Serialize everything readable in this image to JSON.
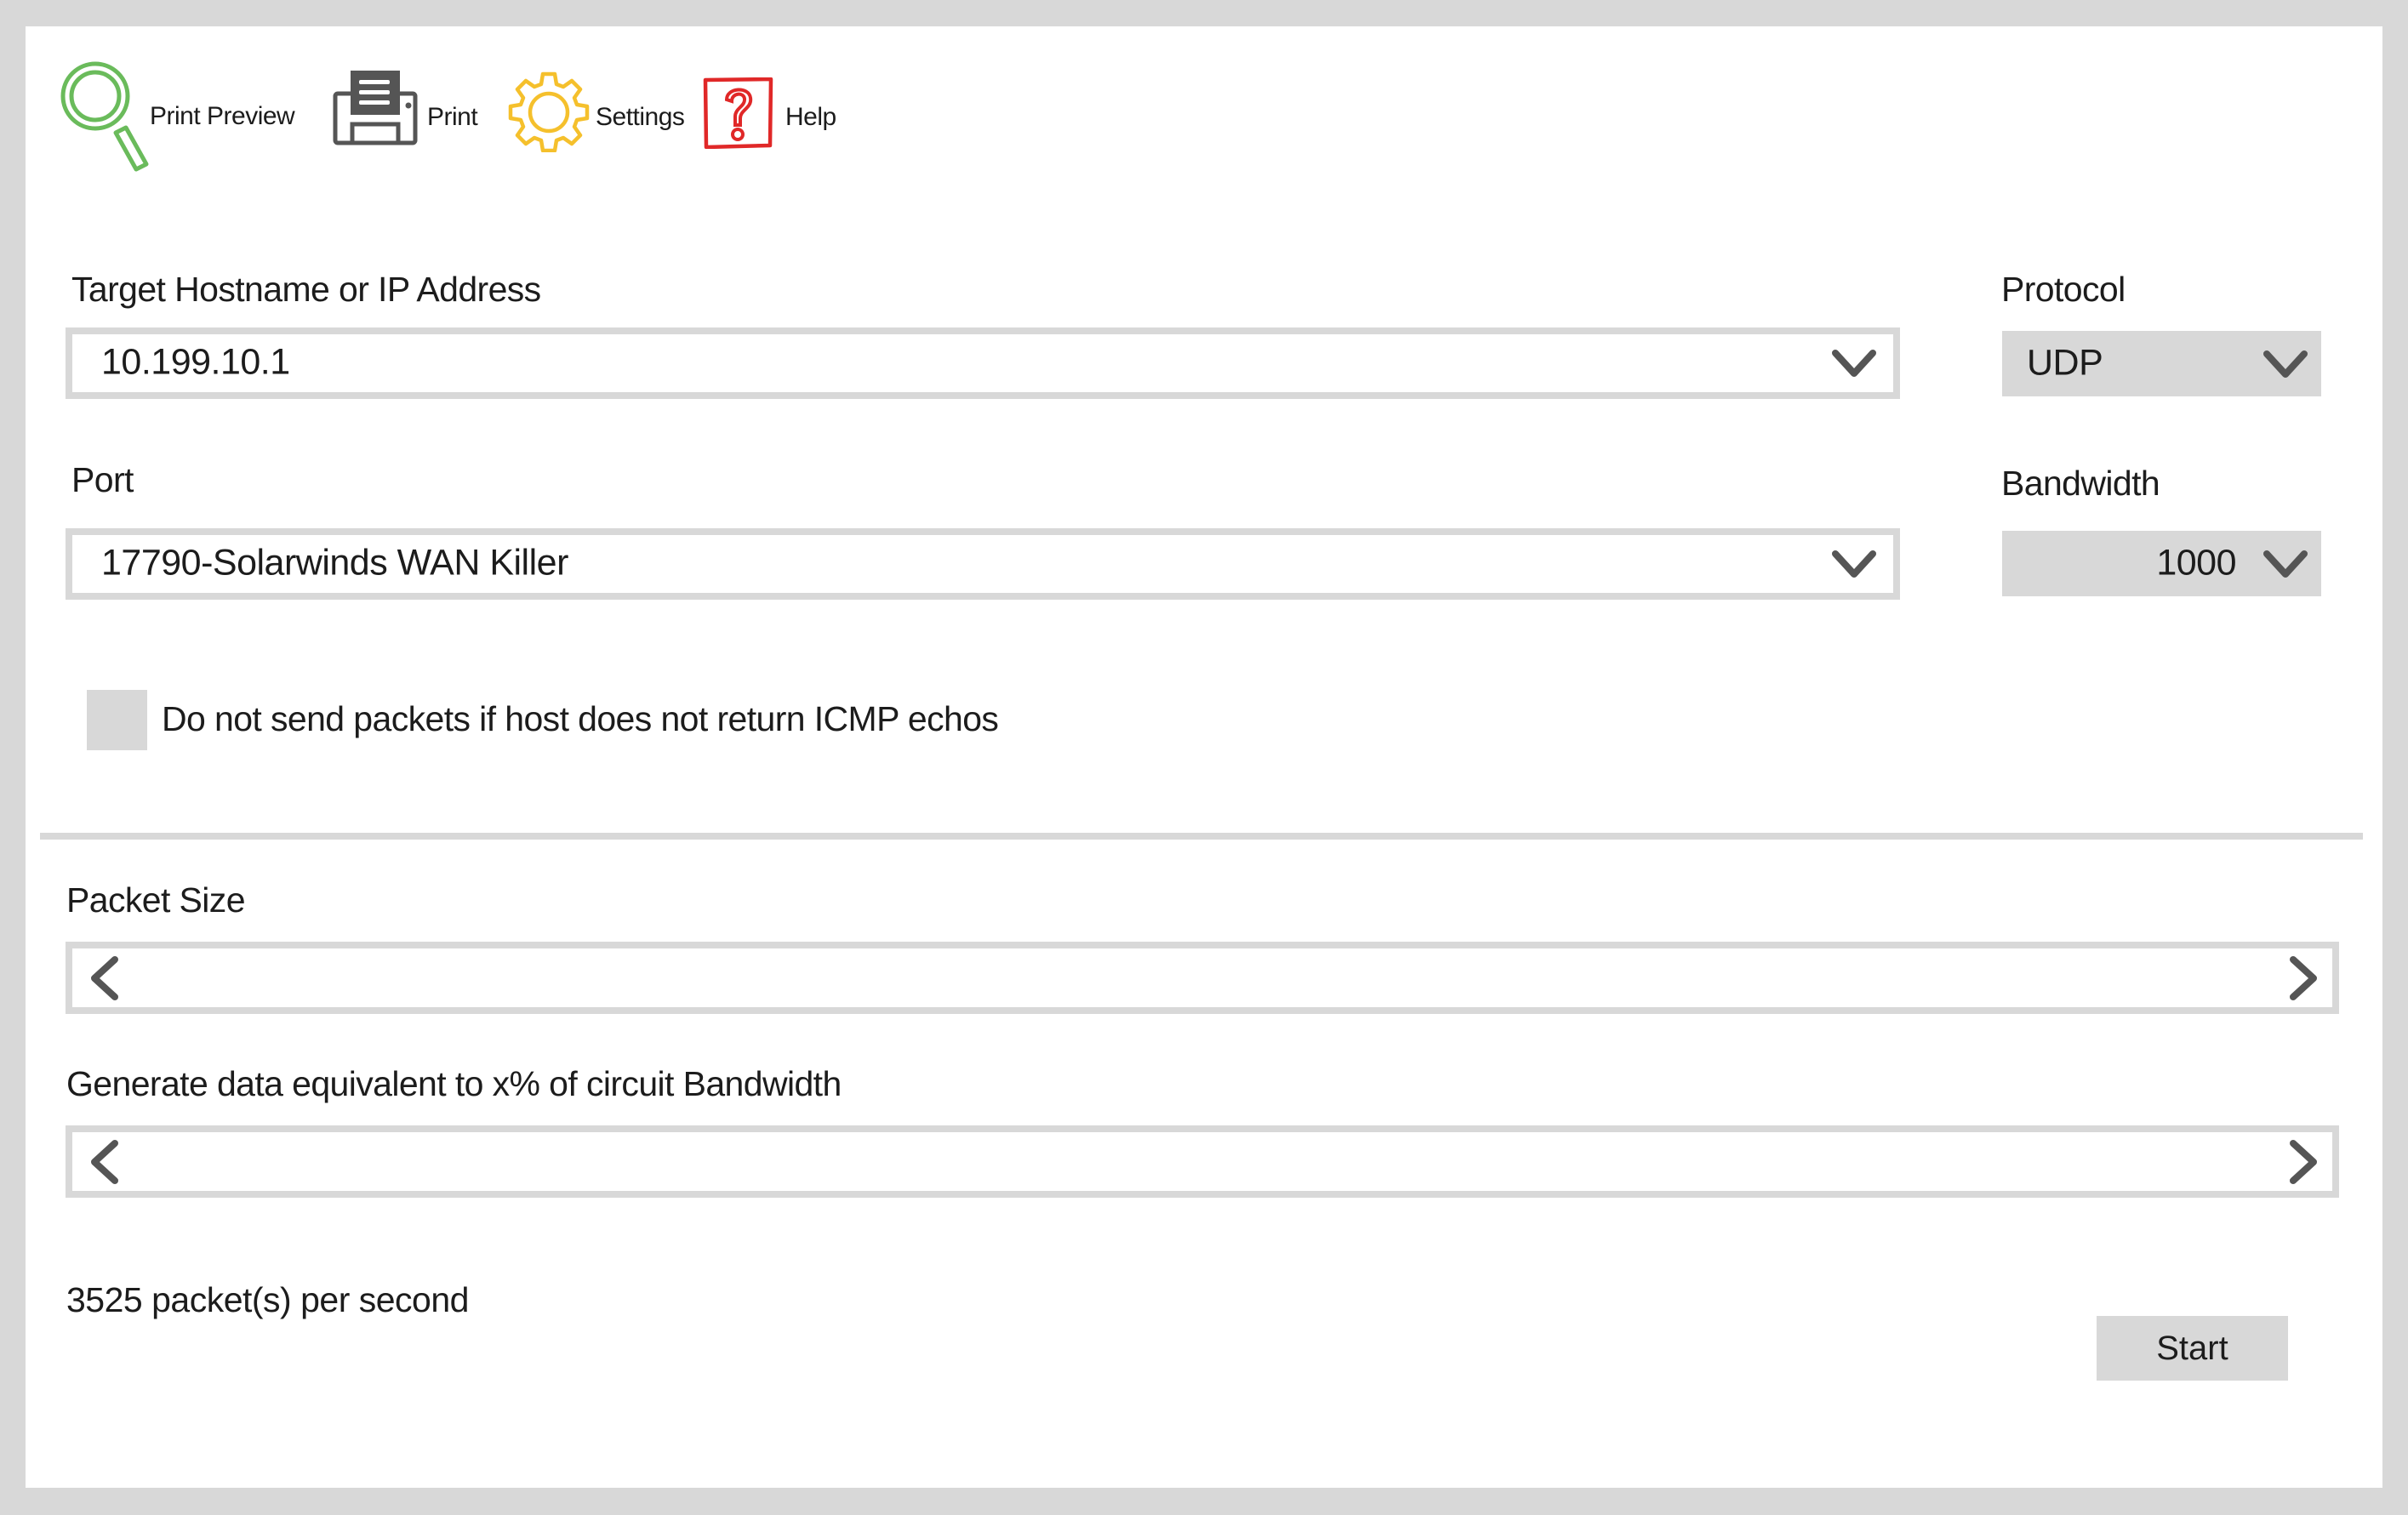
{
  "toolbar": {
    "items": [
      {
        "label": "Print Preview",
        "icon": "magnifier-icon",
        "color": "#6abb5b"
      },
      {
        "label": "Print",
        "icon": "printer-icon",
        "color": "#555555"
      },
      {
        "label": "Settings",
        "icon": "gear-icon",
        "color": "#f5c02c"
      },
      {
        "label": "Help",
        "icon": "help-icon",
        "color": "#e02828"
      }
    ]
  },
  "target": {
    "label": "Target Hostname or IP Address",
    "value": "10.199.10.1"
  },
  "protocol": {
    "label": "Protocol",
    "value": "UDP"
  },
  "port": {
    "label": "Port",
    "value": "17790-Solarwinds WAN Killer"
  },
  "bandwidth": {
    "label": "Bandwidth",
    "value": "1000"
  },
  "icmp_check": {
    "label": "Do not send packets if host does not return ICMP echos",
    "checked": false
  },
  "packet_size": {
    "label": "Packet Size"
  },
  "circuit_percent": {
    "label": "Generate data equivalent to x% of circuit Bandwidth"
  },
  "status": {
    "text": "3525 packet(s) per second"
  },
  "actions": {
    "start_label": "Start"
  },
  "colors": {
    "frame": "#d8d8d8",
    "panel": "#ffffff",
    "chevron": "#555555"
  }
}
